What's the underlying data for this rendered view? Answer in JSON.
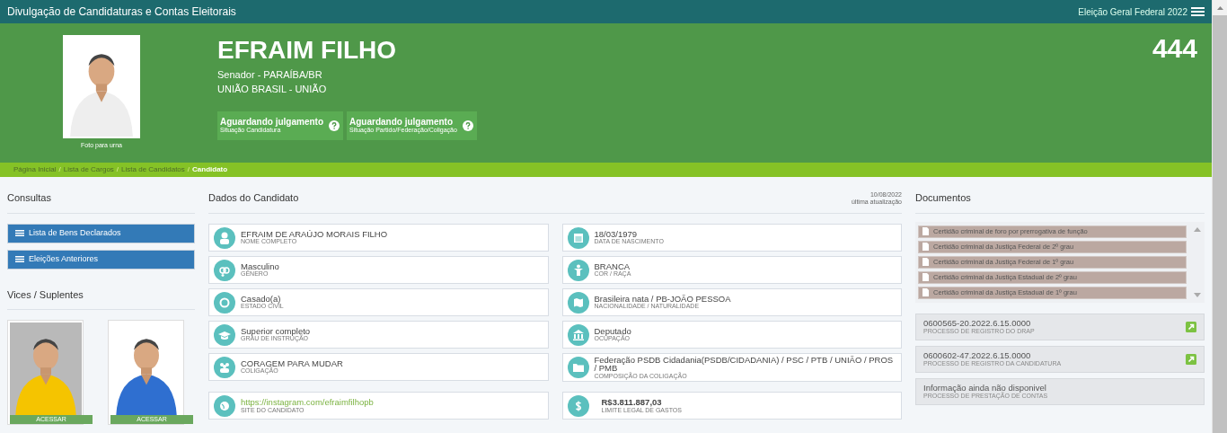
{
  "topbar": {
    "title": "Divulgação de Candidaturas e Contas Eleitorais",
    "election": "Eleição Geral Federal 2022"
  },
  "candidate": {
    "photo_caption": "Foto para urna",
    "name": "EFRAIM FILHO",
    "office": "Senador - PARAÍBA/BR",
    "party": "UNIÃO BRASIL - UNIÃO",
    "number": "444",
    "statuses": [
      {
        "value": "Aguardando julgamento",
        "label": "Situação Candidatura"
      },
      {
        "value": "Aguardando julgamento",
        "label": "Situação Partido/Federação/Coligação"
      }
    ]
  },
  "breadcrumb": [
    {
      "label": "Página Inicial",
      "selected": false
    },
    {
      "separator": "/",
      "label": "Lista de Cargos",
      "selected": false
    },
    {
      "separator": "/",
      "label": "Lista de Candidatos",
      "selected": false
    },
    {
      "separator": "/",
      "label": "Candidato",
      "selected": true
    }
  ],
  "consultas": {
    "title": "Consultas",
    "buttons": [
      "Lista de Bens Declarados",
      "Eleições Anteriores"
    ]
  },
  "vices": {
    "title": "Vices / Suplentes",
    "items": [
      {
        "button": "ACESSAR"
      },
      {
        "button": "ACESSAR"
      }
    ]
  },
  "dados": {
    "title": "Dados do Candidato",
    "updated_date": "10/08/2022",
    "updated_label": "última atualização",
    "fields": [
      {
        "kind": "person",
        "value": "EFRAIM DE ARAÚJO MORAIS FILHO",
        "label": "NOME COMPLETO"
      },
      {
        "kind": "calendar",
        "value": "18/03/1979",
        "label": "DATA DE NASCIMENTO"
      },
      {
        "kind": "gender",
        "value": "Masculino",
        "label": "GÊNERO"
      },
      {
        "kind": "figure",
        "value": "BRANCA",
        "label": "COR / RAÇA"
      },
      {
        "kind": "ring",
        "value": "Casado(a)",
        "label": "ESTADO CIVIL"
      },
      {
        "kind": "map",
        "value": "Brasileira nata / PB-JOÃO PESSOA",
        "label": "NACIONALIDADE / NATURALIDADE"
      },
      {
        "kind": "cap",
        "value": "Superior completo",
        "label": "GRAU DE INSTRUÇÃO"
      },
      {
        "kind": "bank",
        "value": "Deputado",
        "label": "OCUPAÇÃO"
      },
      {
        "kind": "group",
        "value": "CORAGEM PARA MUDAR",
        "label": "COLIGAÇÃO"
      },
      {
        "kind": "folder",
        "value": "Federação PSDB Cidadania(PSDB/CIDADANIA) / PSC / PTB / UNIÃO / PROS / PMB",
        "label": "COMPOSIÇÃO DA COLIGAÇÃO"
      },
      {
        "kind": "link",
        "value": "https://instagram.com/efraimfilhopb",
        "label": "SITE DO CANDIDATO"
      },
      {
        "kind": "money",
        "value": "R$3.811.887,03",
        "label": "LIMITE LEGAL DE GASTOS"
      }
    ]
  },
  "documentos": {
    "title": "Documentos",
    "certidoes": [
      "Certidão criminal de foro por prerrogativa de função",
      "Certidão criminal da Justiça Federal de 2º grau",
      "Certidão criminal da Justiça Federal de 1º grau",
      "Certidão criminal da Justiça Estadual de 2º grau",
      "Certidão criminal da Justiça Estadual de 1º grau"
    ],
    "processos": [
      {
        "number": "0600565-20.2022.6.15.0000",
        "label": "PROCESSO DE REGISTRO DO DRAP",
        "link": true
      },
      {
        "number": "0600602-47.2022.6.15.0000",
        "label": "PROCESSO DE REGISTRO DA CANDIDATURA",
        "link": true
      },
      {
        "number": "Informação ainda não disponivel",
        "label": "PROCESSO DE PRESTAÇÃO DE CONTAS",
        "link": false
      }
    ]
  }
}
